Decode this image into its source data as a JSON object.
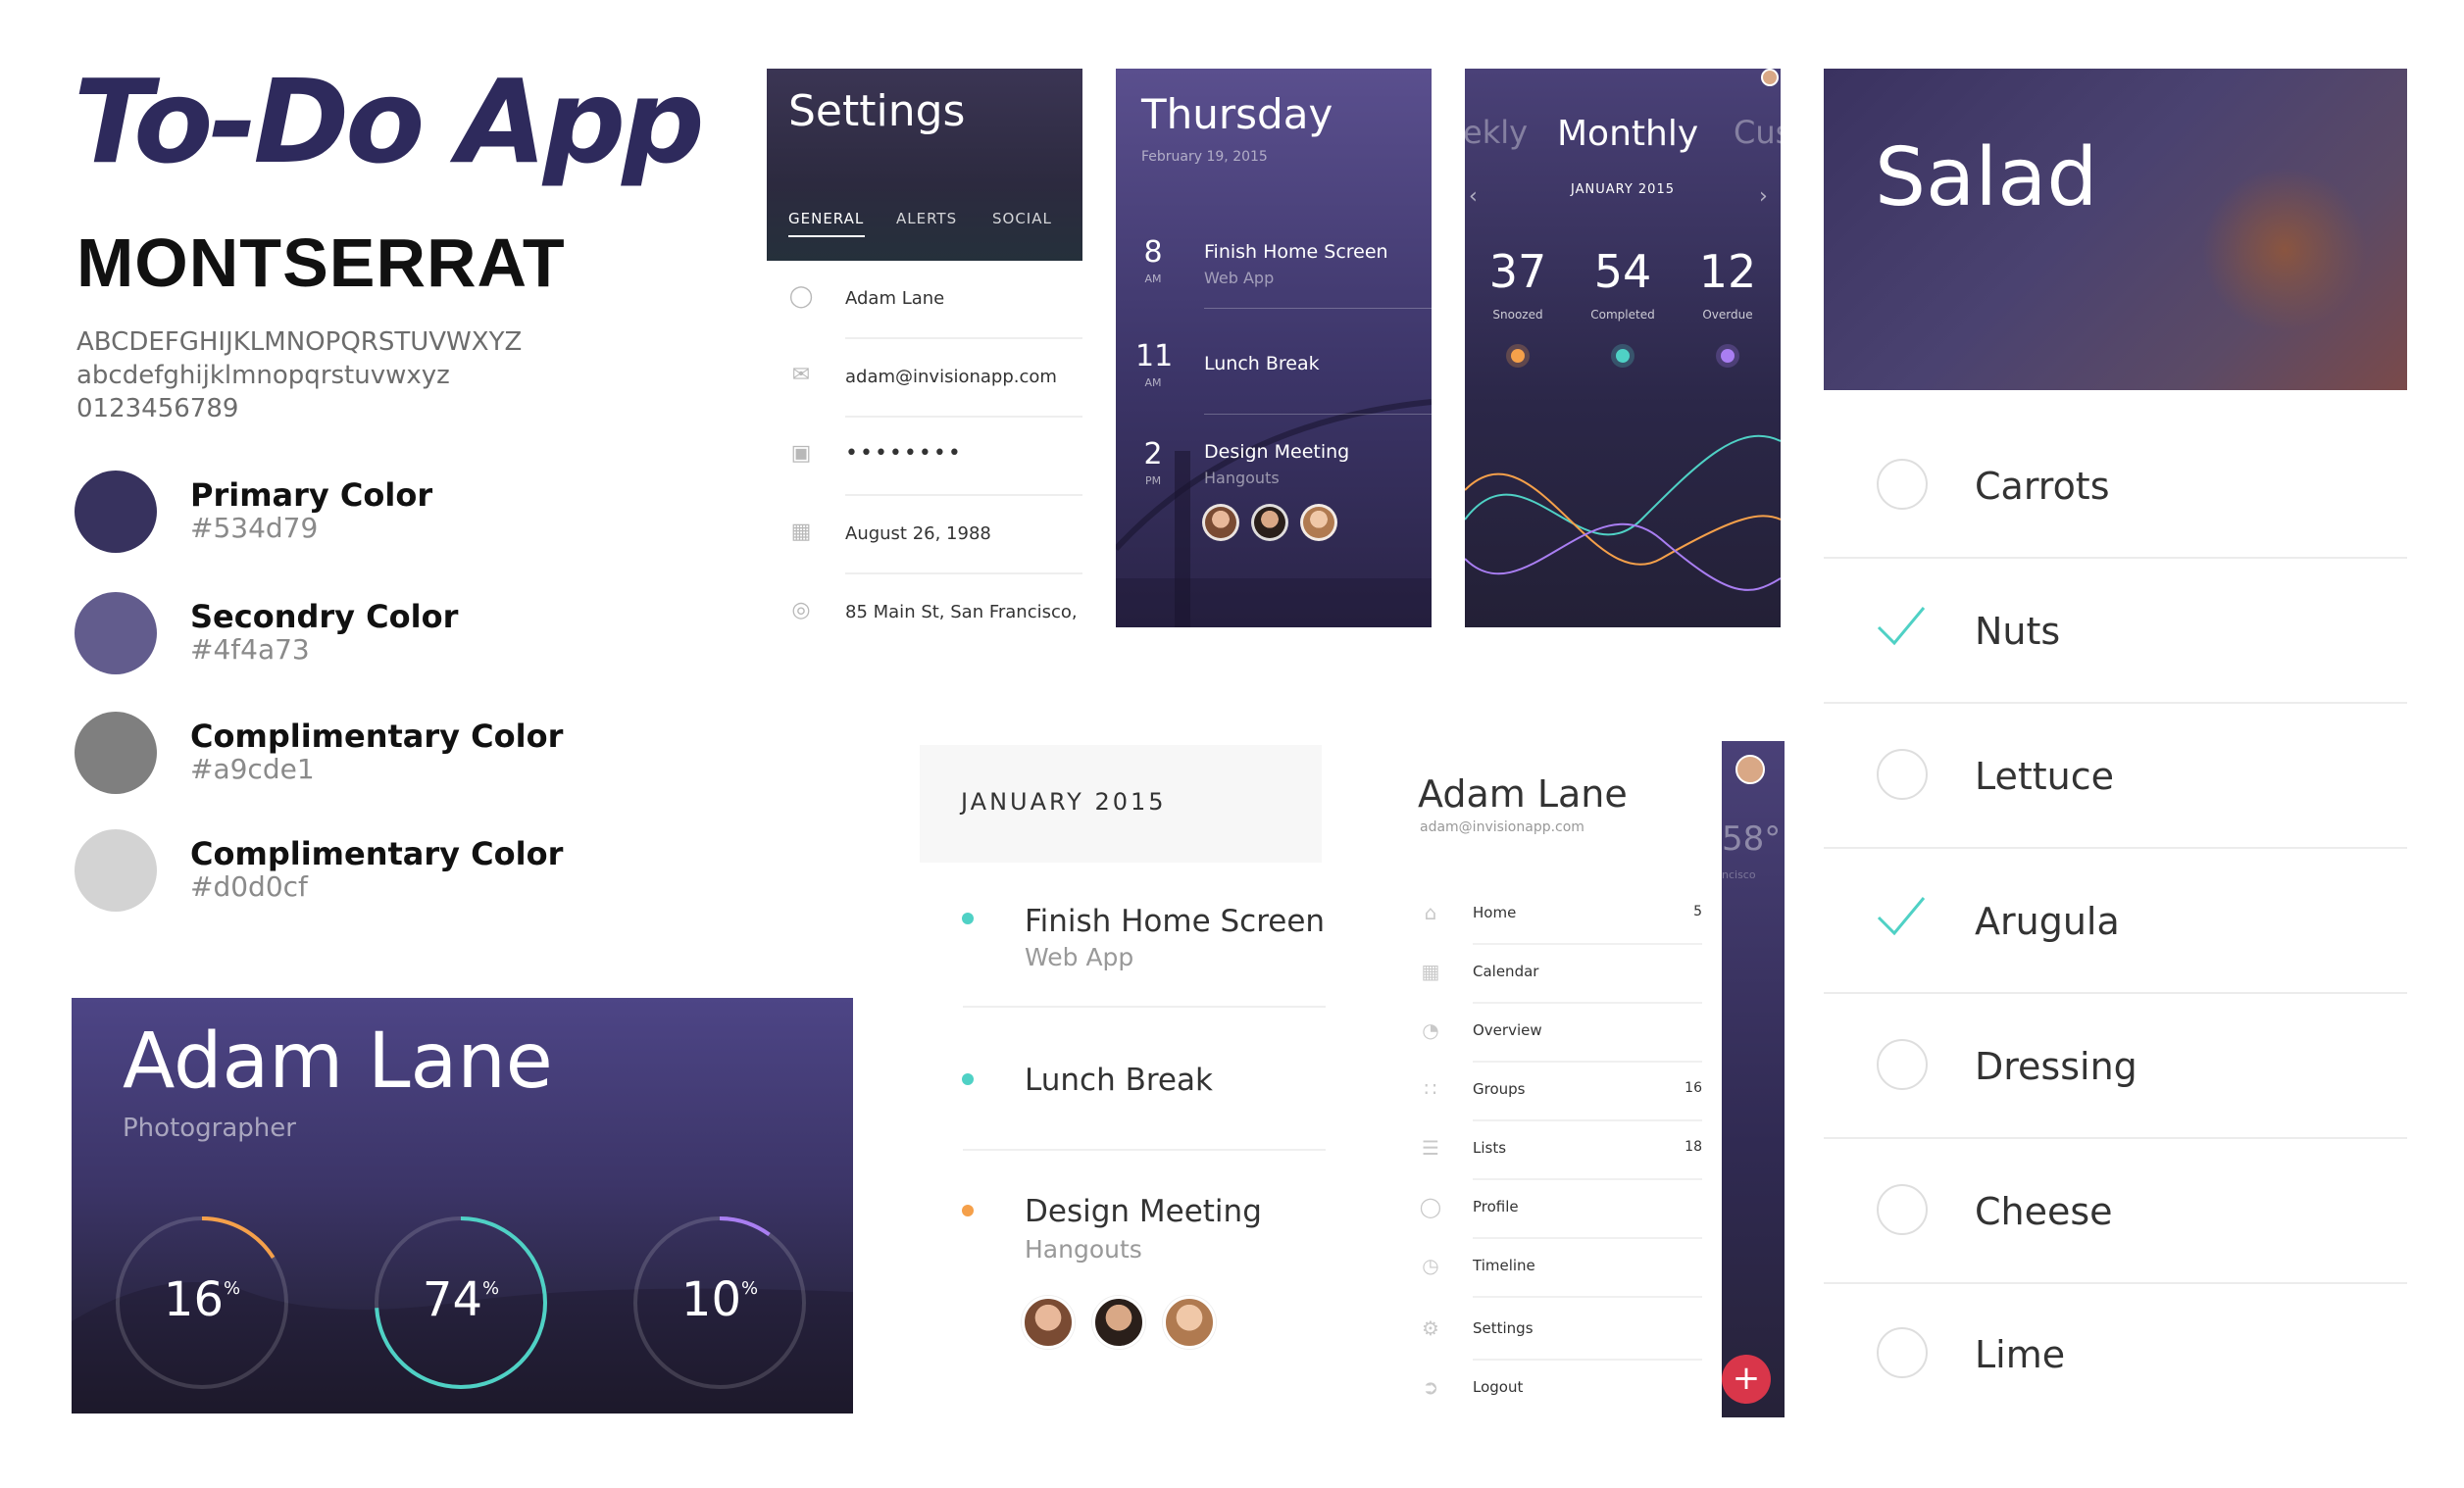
{
  "styleguide": {
    "app_title": "To-Do App",
    "font_name": "MONTSERRAT",
    "uppercase": "ABCDEFGHIJKLMNOPQRSTUVWXYZ",
    "lowercase": "abcdefghijklmnopqrstuvwxyz",
    "digits": "0123456789",
    "colors": [
      {
        "label": "Primary Color",
        "hex": "#534d79",
        "swatch": "#37325e"
      },
      {
        "label": "Secondry Color",
        "hex": "#4f4a73",
        "swatch": "#625c8d"
      },
      {
        "label": "Complimentary  Color",
        "hex": "#a9cde1",
        "swatch": "#7f7f7f"
      },
      {
        "label": "Complimentary  Color",
        "hex": "#d0d0cf",
        "swatch": "#d3d3d3"
      }
    ]
  },
  "settings": {
    "title": "Settings",
    "tabs": [
      "GENERAL",
      "ALERTS",
      "SOCIAL"
    ],
    "active_tab": "GENERAL",
    "rows": [
      {
        "icon": "user-icon",
        "value": "Adam Lane"
      },
      {
        "icon": "mail-icon",
        "value": "adam@invisionapp.com"
      },
      {
        "icon": "lock-icon",
        "value": "••••••••"
      },
      {
        "icon": "gift-icon",
        "value": "August 26, 1988"
      },
      {
        "icon": "location-icon",
        "value": "85 Main St, San Francisco, C..."
      }
    ]
  },
  "thursday": {
    "day": "Thursday",
    "date": "February 19, 2015",
    "items": [
      {
        "hour": "8",
        "ampm": "AM",
        "title": "Finish Home Screen",
        "sub": "Web App"
      },
      {
        "hour": "11",
        "ampm": "AM",
        "title": "Lunch Break",
        "sub": ""
      },
      {
        "hour": "2",
        "ampm": "PM",
        "title": "Design Meeting",
        "sub": "Hangouts"
      }
    ]
  },
  "monthly": {
    "prev_tab": "ekly",
    "title": "Monthly",
    "next_tab": "Cus",
    "month": "JANUARY 2015",
    "stats": [
      {
        "value": "37",
        "label": "Snoozed",
        "color": "#f5a04a"
      },
      {
        "value": "54",
        "label": "Completed",
        "color": "#4fd1c5"
      },
      {
        "value": "12",
        "label": "Overdue",
        "color": "#a97ef2"
      }
    ]
  },
  "salad": {
    "title": "Salad",
    "items": [
      {
        "label": "Carrots",
        "checked": false
      },
      {
        "label": "Nuts",
        "checked": true
      },
      {
        "label": "Lettuce",
        "checked": false
      },
      {
        "label": "Arugula",
        "checked": true
      },
      {
        "label": "Dressing",
        "checked": false
      },
      {
        "label": "Cheese",
        "checked": false
      },
      {
        "label": "Lime",
        "checked": false
      }
    ]
  },
  "calendar": {
    "month": "JANUARY 2015",
    "items": [
      {
        "title": "Finish Home Screen",
        "sub": "Web App",
        "color": "#4fd1c5"
      },
      {
        "title": "Lunch Break",
        "sub": "",
        "color": "#4fd1c5"
      },
      {
        "title": "Design Meeting",
        "sub": "Hangouts",
        "color": "#f5a04a"
      }
    ]
  },
  "drawer": {
    "name": "Adam Lane",
    "email": "adam@invisionapp.com",
    "side_temp": "58°",
    "side_city": "ncisco",
    "items": [
      {
        "icon": "home-icon",
        "label": "Home",
        "count": "5"
      },
      {
        "icon": "calendar-icon",
        "label": "Calendar",
        "count": ""
      },
      {
        "icon": "overview-icon",
        "label": "Overview",
        "count": ""
      },
      {
        "icon": "groups-icon",
        "label": "Groups",
        "count": "16"
      },
      {
        "icon": "lists-icon",
        "label": "Lists",
        "count": "18"
      },
      {
        "icon": "profile-icon",
        "label": "Profile",
        "count": ""
      },
      {
        "icon": "timeline-icon",
        "label": "Timeline",
        "count": ""
      },
      {
        "icon": "settings-icon",
        "label": "Settings",
        "count": ""
      },
      {
        "icon": "logout-icon",
        "label": "Logout",
        "count": ""
      }
    ]
  },
  "profile": {
    "name": "Adam Lane",
    "role": "Photographer",
    "rings": [
      {
        "value": "16",
        "unit": "%",
        "fraction": 0.16,
        "color": "#f5a04a"
      },
      {
        "value": "74",
        "unit": "%",
        "fraction": 0.74,
        "color": "#4fd1c5"
      },
      {
        "value": "10",
        "unit": "%",
        "fraction": 0.1,
        "color": "#a97ef2"
      }
    ]
  }
}
